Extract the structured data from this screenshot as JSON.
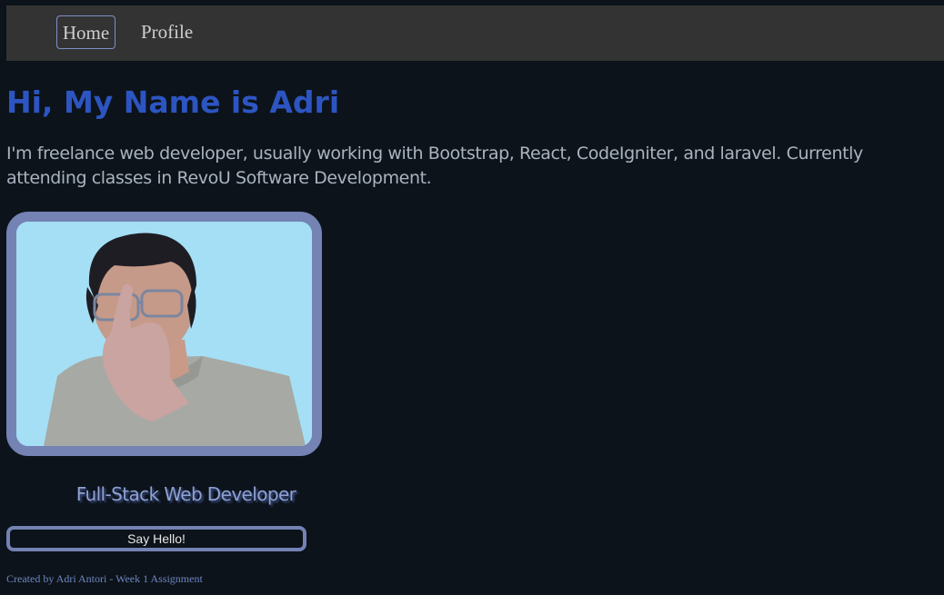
{
  "nav": {
    "home_label": "Home",
    "profile_label": "Profile"
  },
  "hero": {
    "title": "Hi, My Name is Adri",
    "intro": "I'm freelance web developer, usually working with Bootstrap, React, CodeIgniter, and laravel. Currently attending classes in RevoU Software Development."
  },
  "profile": {
    "role": "Full-Stack Web Developer",
    "button_label": "Say Hello!"
  },
  "footer": {
    "text": "Created by Adri Antori - Week 1 Assignment"
  },
  "colors": {
    "background": "#0c131a",
    "navbar": "#333333",
    "title": "#2d55c2",
    "frame": "#7482b4",
    "photo_background": "#a4dff5"
  }
}
